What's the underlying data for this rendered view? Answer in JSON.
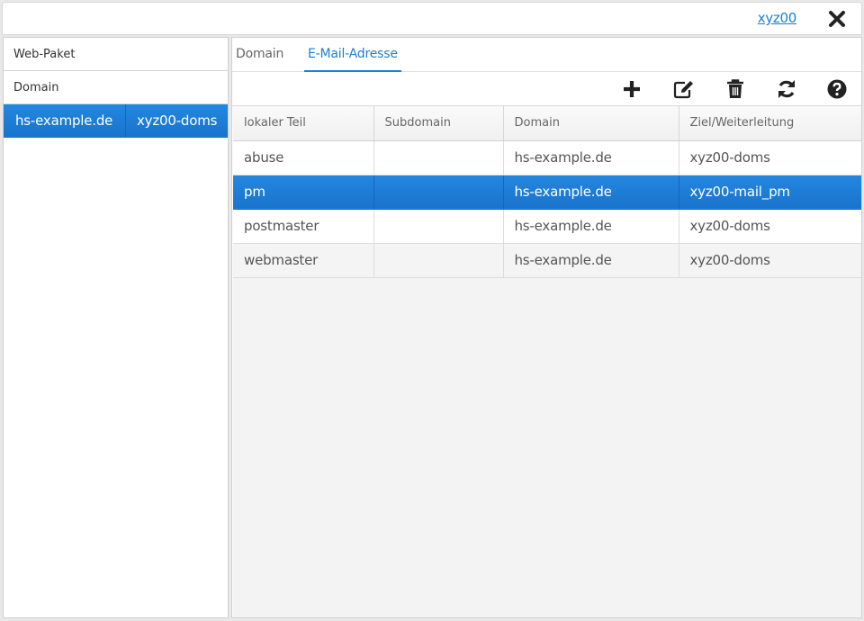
{
  "header": {
    "user": "xyz00"
  },
  "left_panel": {
    "sections": [
      {
        "label": "Web-Paket"
      },
      {
        "label": "Domain"
      }
    ],
    "selected_row": {
      "domain": "hs-example.de",
      "owner": "xyz00-doms"
    }
  },
  "tabs": [
    {
      "label": "Domain"
    },
    {
      "label": "E-Mail-Adresse",
      "active": true
    }
  ],
  "toolbar": [
    "plus-icon",
    "edit-icon",
    "trash-icon",
    "refresh-icon",
    "help-icon"
  ],
  "table": {
    "columns": [
      "lokaler Teil",
      "Subdomain",
      "Domain",
      "Ziel/Weiterleitung"
    ],
    "rows": [
      {
        "local": "abuse",
        "subdomain": "",
        "domain": "hs-example.de",
        "target": "xyz00-doms"
      },
      {
        "local": "pm",
        "subdomain": "",
        "domain": "hs-example.de",
        "target": "xyz00-mail_pm",
        "selected": true
      },
      {
        "local": "postmaster",
        "subdomain": "",
        "domain": "hs-example.de",
        "target": "xyz00-doms"
      },
      {
        "local": "webmaster",
        "subdomain": "",
        "domain": "hs-example.de",
        "target": "xyz00-doms"
      }
    ]
  },
  "colors": {
    "accent": "#1a7fd4",
    "selection": "#1e7dd8"
  }
}
